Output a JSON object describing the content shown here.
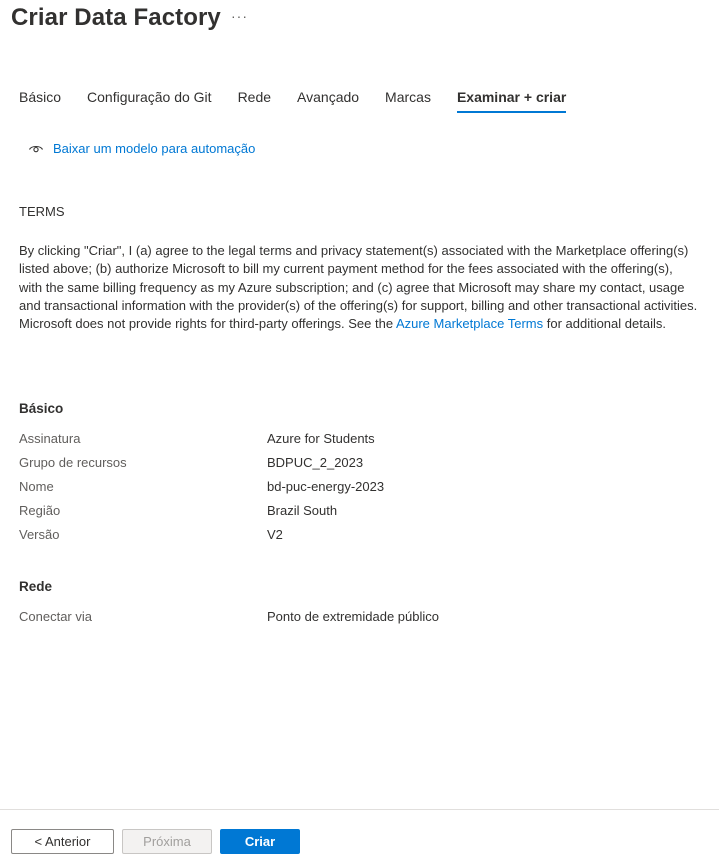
{
  "header": {
    "title": "Criar Data Factory",
    "more_label": "···"
  },
  "tabs": [
    {
      "label": "Básico",
      "active": false
    },
    {
      "label": "Configuração do Git",
      "active": false
    },
    {
      "label": "Rede",
      "active": false
    },
    {
      "label": "Avançado",
      "active": false
    },
    {
      "label": "Marcas",
      "active": false
    },
    {
      "label": "Examinar + criar",
      "active": true
    }
  ],
  "download_link": {
    "icon": "eye-icon",
    "label": "Baixar um modelo para automação"
  },
  "terms": {
    "heading": "TERMS",
    "body_before_link": "By clicking \"Criar\", I (a) agree to the legal terms and privacy statement(s) associated with the Marketplace offering(s) listed above; (b) authorize Microsoft to bill my current payment method for the fees associated with the offering(s), with the same billing frequency as my Azure subscription; and (c) agree that Microsoft may share my contact, usage and transactional information with the provider(s) of the offering(s) for support, billing and other transactional activities. Microsoft does not provide rights for third-party offerings. See the ",
    "link_text": "Azure Marketplace Terms",
    "body_after_link": " for additional details."
  },
  "sections": {
    "basico": {
      "heading": "Básico",
      "rows": [
        {
          "key": "Assinatura",
          "value": "Azure for Students"
        },
        {
          "key": "Grupo de recursos",
          "value": "BDPUC_2_2023"
        },
        {
          "key": "Nome",
          "value": "bd-puc-energy-2023"
        },
        {
          "key": "Região",
          "value": "Brazil South"
        },
        {
          "key": "Versão",
          "value": "V2"
        }
      ]
    },
    "rede": {
      "heading": "Rede",
      "rows": [
        {
          "key": "Conectar via",
          "value": "Ponto de extremidade público"
        }
      ]
    }
  },
  "footer": {
    "prev_label": "< Anterior",
    "next_label": "Próxima",
    "create_label": "Criar"
  },
  "colors": {
    "accent": "#0078d4",
    "text": "#323130",
    "muted": "#605e5c"
  }
}
